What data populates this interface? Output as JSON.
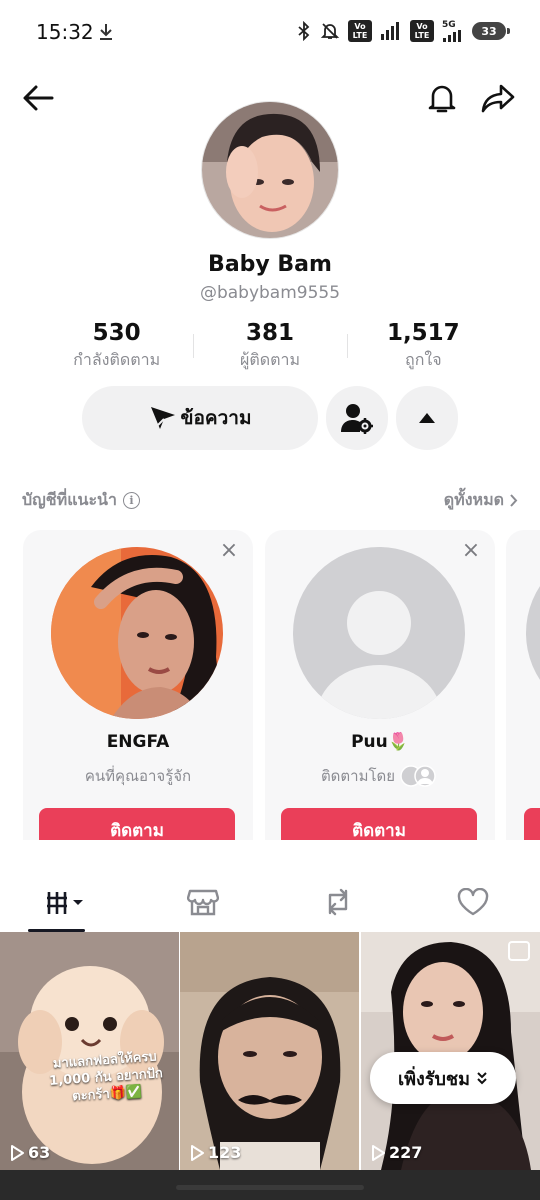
{
  "status_bar": {
    "time": "15:32",
    "volte_label_top": "Vo",
    "volte_label_bottom": "LTE",
    "network": "5G",
    "battery": "33"
  },
  "profile": {
    "display_name": "Baby Bam",
    "username": "@babybam9555",
    "stats": [
      {
        "value": "530",
        "label": "กำลังติดตาม"
      },
      {
        "value": "381",
        "label": "ผู้ติดตาม"
      },
      {
        "value": "1,517",
        "label": "ถูกใจ"
      }
    ],
    "message_button": "ข้อความ"
  },
  "suggested": {
    "title": "บัญชีที่แนะนำ",
    "see_all": "ดูทั้งหมด",
    "cards": [
      {
        "name": "ENGFA",
        "reason": "คนที่คุณอาจรู้จัก",
        "follow": "ติดตาม"
      },
      {
        "name": "Puu🌷",
        "reason": "ติดตามโดย",
        "follow": "ติดตาม"
      }
    ]
  },
  "videos": [
    {
      "views": "63",
      "caption": "มาแลกฟอลให้ครบ 1,000 กัน อยากปักตะกร้า🎁✅"
    },
    {
      "views": "123"
    },
    {
      "views": "227"
    }
  ],
  "more_button": "เพิ่งรับชม",
  "colors": {
    "accent": "#ea3f59",
    "muted": "#8a8b91",
    "surface": "#f1f1f2"
  }
}
